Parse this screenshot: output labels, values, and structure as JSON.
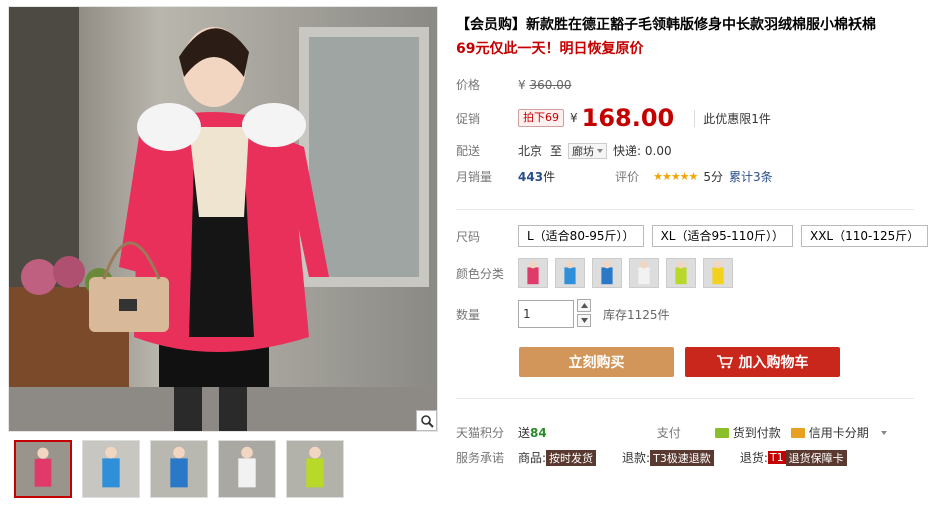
{
  "product": {
    "title": "【会员购】新款胜在德正豁子毛领韩版修身中长款羽绒棉服小棉袄棉",
    "subtitle": "69元仅此一天！明日恢复原价"
  },
  "price": {
    "label": "价格",
    "currency": "¥",
    "original": "360.00"
  },
  "promo": {
    "label": "促销",
    "badge": "拍下69",
    "currency": "¥",
    "price": "168.00",
    "note": "此优惠限1件"
  },
  "shipping": {
    "label": "配送",
    "from": "北京",
    "to_word": "至",
    "city": "廊坊",
    "express": "快递: 0.00"
  },
  "sales": {
    "label": "月销量",
    "count": "443",
    "unit": "件",
    "review_label": "评价",
    "stars": "★★★★★",
    "score": "5分",
    "total_reviews": "累计3条"
  },
  "size": {
    "label": "尺码",
    "options": [
      "L（适合80-95斤））",
      "XL（适合95-110斤））",
      "XXL（110-125斤）"
    ]
  },
  "color": {
    "label": "颜色分类",
    "swatches": [
      {
        "name": "rose-red",
        "color": "#e03a6a"
      },
      {
        "name": "sky-blue",
        "color": "#2f8fd8"
      },
      {
        "name": "blue",
        "color": "#2a78c8"
      },
      {
        "name": "white",
        "color": "#f2f2f2"
      },
      {
        "name": "lime",
        "color": "#b8d82a"
      },
      {
        "name": "yellow",
        "color": "#f2d21e"
      }
    ]
  },
  "quantity": {
    "label": "数量",
    "value": "1",
    "stock": "库存1125件"
  },
  "actions": {
    "buy_now": "立刻购买",
    "add_cart": "加入购物车"
  },
  "points": {
    "label": "天猫积分",
    "prefix": "送",
    "value": "84",
    "pay_label": "支付",
    "cod": "货到付款",
    "credit": "信用卡分期"
  },
  "service": {
    "label": "服务承诺",
    "goods_label": "商品:",
    "goods_tag": "按时发货",
    "refund_label": "退款:",
    "refund_tag": "T3极速退款",
    "return_label": "退货:",
    "return_tag_prefix": "T1",
    "return_tag": "退货保障卡"
  },
  "colors": {
    "accent_red": "#c40000",
    "buy_button": "#d3965a",
    "cart_button": "#c9261c",
    "link_blue": "#2a4e8b"
  }
}
